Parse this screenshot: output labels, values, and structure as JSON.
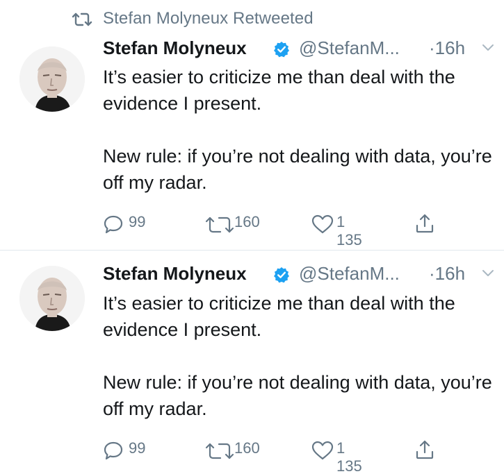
{
  "retweet_context": {
    "icon": "retweet-icon",
    "text": "Stefan Molyneux Retweeted"
  },
  "tweets": [
    {
      "author_name": "Stefan Molyneux",
      "verified": true,
      "handle": "@StefanM...",
      "time": "·16h",
      "body": [
        "It’s easier to criticize me than deal with the evidence I present.",
        "New rule: if you’re not dealing with data, you’re off my radar."
      ],
      "actions": {
        "reply_count": "99",
        "retweet_count": "160",
        "like_count": "1 135"
      }
    },
    {
      "author_name": "Stefan Molyneux",
      "verified": true,
      "handle": "@StefanM...",
      "time": "·16h",
      "body": [
        "It’s easier to criticize me than deal with the evidence I present.",
        "New rule: if you’re not dealing with data, you’re off my radar."
      ],
      "actions": {
        "reply_count": "99",
        "retweet_count": "160",
        "like_count": "1 135"
      }
    }
  ],
  "colors": {
    "text_primary": "#14171a",
    "text_secondary": "#657786",
    "verified_blue": "#1da1f2",
    "divider": "#e1e8ed"
  }
}
